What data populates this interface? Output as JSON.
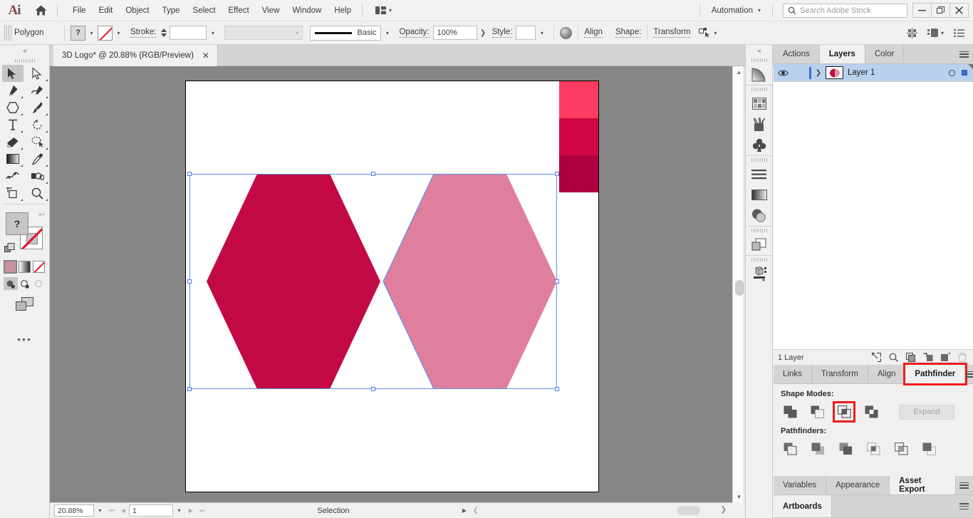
{
  "app": {
    "name": "Adobe Illustrator",
    "logo": "Ai"
  },
  "menubar": {
    "items": [
      "File",
      "Edit",
      "Object",
      "Type",
      "Select",
      "Effect",
      "View",
      "Window",
      "Help"
    ],
    "workspace": "Automation",
    "search_placeholder": "Search Adobe Stock",
    "window_buttons": {
      "minimize": "—",
      "restore": "❐",
      "close": "✕"
    }
  },
  "controlbar": {
    "selection_label": "Polygon",
    "fill_label": "?",
    "stroke_label": "Stroke:",
    "stroke_weight": "",
    "profile_value": "",
    "brush_label": "Basic",
    "opacity_label": "Opacity:",
    "opacity_value": "100%",
    "style_label": "Style:",
    "align_label": "Align",
    "shape_label": "Shape:",
    "transform_label": "Transform"
  },
  "document": {
    "tab_title": "3D Logo* @ 20.88% (RGB/Preview)",
    "close_glyph": "✕"
  },
  "toolbar": {
    "collapse_glyph": "«",
    "tools": [
      {
        "name": "selection-tool",
        "selected": true
      },
      {
        "name": "direct-selection-tool",
        "selected": false
      },
      {
        "name": "pen-tool",
        "selected": false
      },
      {
        "name": "curvature-tool",
        "selected": false
      },
      {
        "name": "shape-tool",
        "selected": false
      },
      {
        "name": "paintbrush-tool",
        "selected": false
      },
      {
        "name": "type-tool",
        "selected": false
      },
      {
        "name": "rotate-tool",
        "selected": false
      },
      {
        "name": "eraser-tool",
        "selected": false
      },
      {
        "name": "lasso-tool",
        "selected": false
      },
      {
        "name": "gradient-tool",
        "selected": false
      },
      {
        "name": "eyedropper-tool",
        "selected": false
      },
      {
        "name": "width-tool",
        "selected": false
      },
      {
        "name": "shape-builder-tool",
        "selected": false
      },
      {
        "name": "artboard-tool",
        "selected": false
      },
      {
        "name": "zoom-tool",
        "selected": false
      }
    ],
    "fill_swatch_label": "?",
    "color_modes": [
      "color-swatch",
      "gradient-swatch",
      "none-swatch"
    ],
    "draw_modes": [
      "draw-normal",
      "draw-behind",
      "draw-inside"
    ],
    "more_tools_glyph": "•••"
  },
  "canvas": {
    "background_color": "#868686",
    "artboard_color": "#ffffff",
    "swatches": [
      {
        "name": "pink-swatch",
        "color": "#FB3D63"
      },
      {
        "name": "crimson-swatch",
        "color": "#D00544"
      },
      {
        "name": "dark-crimson-swatch",
        "color": "#AE0040"
      }
    ],
    "shapes": [
      {
        "name": "left-hexagon",
        "color": "#C30944",
        "opacity": 1
      },
      {
        "name": "right-hexagon",
        "color": "#C30944",
        "opacity": 0.5
      }
    ],
    "selection_color": "#5b8ef5"
  },
  "right_rail": {
    "collapse_glyph": "«",
    "icons": [
      "gradient-panel-icon",
      "swatches-panel-icon",
      "brushes-panel-icon",
      "symbols-panel-icon",
      "paragraph-panel-icon",
      "gradient-icon",
      "transparency-icon",
      "layers-panel-icon",
      "3d-panel-icon"
    ]
  },
  "panels": {
    "top_group": {
      "tabs": [
        {
          "label": "Actions",
          "active": false
        },
        {
          "label": "Layers",
          "active": true
        },
        {
          "label": "Color",
          "active": false
        }
      ],
      "layers": [
        {
          "name": "Layer 1",
          "visible": true,
          "selected": true,
          "thumb_color": "#C30944"
        }
      ],
      "footer_count": "1 Layer",
      "footer_icons": [
        "locate-object-icon",
        "make-clipping-mask-icon",
        "create-new-sublayer-icon",
        "create-new-layer-icon",
        "delete-selection-icon"
      ]
    },
    "pathfinder_group": {
      "tabs": [
        {
          "label": "Links",
          "active": false
        },
        {
          "label": "Transform",
          "active": false
        },
        {
          "label": "Align",
          "active": false
        },
        {
          "label": "Pathfinder",
          "active": true,
          "highlighted": true
        }
      ],
      "shape_modes_label": "Shape Modes:",
      "shape_modes": [
        {
          "name": "unite-button",
          "highlighted": false
        },
        {
          "name": "minus-front-button",
          "highlighted": false
        },
        {
          "name": "intersect-button",
          "highlighted": true
        },
        {
          "name": "exclude-button",
          "highlighted": false
        }
      ],
      "expand_label": "Expand",
      "pathfinders_label": "Pathfinders:",
      "pathfinders": [
        {
          "name": "divide-button"
        },
        {
          "name": "trim-button"
        },
        {
          "name": "merge-button"
        },
        {
          "name": "crop-button"
        },
        {
          "name": "outline-button"
        },
        {
          "name": "minus-back-button"
        }
      ]
    },
    "bottom_group": {
      "tabs": [
        {
          "label": "Variables",
          "active": false
        },
        {
          "label": "Appearance",
          "active": false
        },
        {
          "label": "Asset Export",
          "active": true
        }
      ]
    },
    "artboards_group": {
      "tabs": [
        {
          "label": "Artboards",
          "active": true
        }
      ]
    }
  },
  "statusbar": {
    "zoom_value": "20.88%",
    "page_value": "1",
    "status_text": "Selection"
  },
  "accent": {
    "highlight_red": "#EE1C1C",
    "selection_blue": "#5b8ef5",
    "layer_row_blue": "#b9d1ec"
  }
}
